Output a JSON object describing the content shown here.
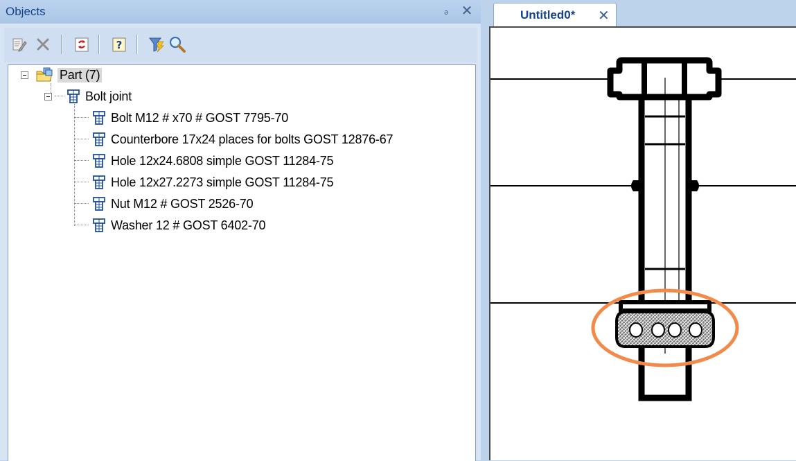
{
  "objects_panel": {
    "title": "Objects",
    "pin_glyph": "ₔ",
    "close_glyph": "✕",
    "toolbar": {
      "icons": [
        "edit-icon",
        "delete-icon",
        "refresh-icon",
        "help-icon",
        "filter-icon",
        "search-icon"
      ]
    },
    "tree": {
      "root": {
        "label": "Part (7)"
      },
      "group": {
        "label": "Bolt joint"
      },
      "items": [
        {
          "label": "Bolt M12 # x70 # GOST 7795-70"
        },
        {
          "label": "Counterbore 17x24 places for bolts GOST 12876-67"
        },
        {
          "label": "Hole 12x24.6808 simple GOST 11284-75"
        },
        {
          "label": "Hole 12x27.2273 simple GOST 11284-75"
        },
        {
          "label": "Nut M12 # GOST 2526-70"
        },
        {
          "label": "Washer 12  # GOST 6402-70"
        }
      ]
    }
  },
  "document": {
    "tab_label": "Untitled0*",
    "tab_close_glyph": "✕"
  },
  "colors": {
    "title_text": "#15428b",
    "highlight_ellipse": "#f28a4b",
    "selection_bg": "#d9d9d9"
  }
}
